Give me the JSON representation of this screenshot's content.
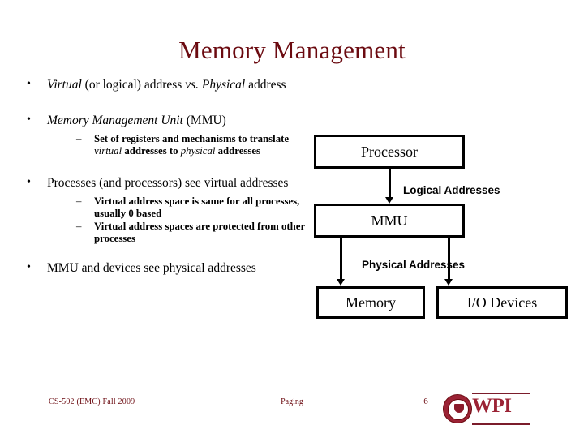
{
  "slide": {
    "title": "Memory Management",
    "title_color": "#6B0A10",
    "background_color": "#ffffff"
  },
  "bullets": [
    {
      "marker": "•",
      "segments": [
        {
          "text": "Virtual",
          "italic": true
        },
        {
          "text": " (or logical) address ",
          "italic": false
        },
        {
          "text": "vs.",
          "italic": true
        },
        {
          "text": " ",
          "italic": false
        },
        {
          "text": "Physical",
          "italic": true
        },
        {
          "text": " address",
          "italic": false
        }
      ]
    },
    {
      "marker": "•",
      "segments": [
        {
          "text": "Memory Management Unit",
          "italic": true
        },
        {
          "text": " (MMU)",
          "italic": false
        }
      ],
      "sub": [
        {
          "marker": "–",
          "segments": [
            {
              "text": "Set of registers and mechanisms to translate ",
              "italic": false
            },
            {
              "text": "virtual",
              "italic": true
            },
            {
              "text": " addresses to ",
              "italic": false
            },
            {
              "text": "physical",
              "italic": true
            },
            {
              "text": " addresses",
              "italic": false
            }
          ]
        }
      ]
    },
    {
      "marker": "•",
      "segments": [
        {
          "text": "Processes (and processors) see virtual addresses",
          "italic": false
        }
      ],
      "sub": [
        {
          "marker": "–",
          "segments": [
            {
              "text": "Virtual address space is same for all processes, usually 0 based",
              "italic": false
            }
          ]
        },
        {
          "marker": "–",
          "segments": [
            {
              "text": "Virtual address spaces are protected from other processes",
              "italic": false
            }
          ]
        }
      ]
    },
    {
      "marker": "•",
      "segments": [
        {
          "text": "MMU and devices see physical addresses",
          "italic": false
        }
      ]
    }
  ],
  "diagram": {
    "boxes": {
      "processor": "Processor",
      "mmu": "MMU",
      "memory": "Memory",
      "io_devices": "I/O Devices"
    },
    "labels": {
      "logical": "Logical Addresses",
      "physical": "Physical Addresses"
    }
  },
  "footer": {
    "course": "CS-502 (EMC) Fall 2009",
    "topic": "Paging",
    "page_number": "6",
    "logo_text": "WPI",
    "text_color": "#6B0A10"
  }
}
